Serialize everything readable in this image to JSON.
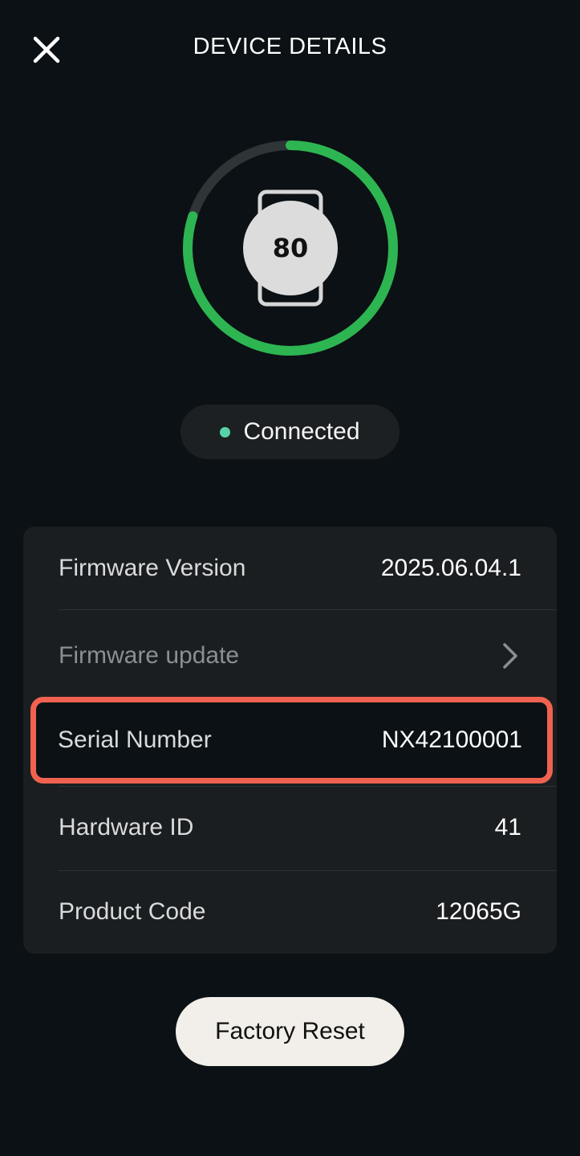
{
  "header": {
    "title": "DEVICE DETAILS",
    "close_icon": "close-icon"
  },
  "device": {
    "battery_level": "80",
    "battery_fraction": 0.8,
    "icon": "watch-icon",
    "ring_color": "#2db552",
    "ring_track_color": "#2f3436"
  },
  "status": {
    "label": "Connected",
    "dot_color": "#58d3a8"
  },
  "details": {
    "firmware_version_label": "Firmware Version",
    "firmware_version_value": "2025.06.04.1",
    "firmware_update_label": "Firmware update",
    "firmware_update_icon": "chevron-right-icon",
    "serial_number_label": "Serial Number",
    "serial_number_value": "NX42100001",
    "hardware_id_label": "Hardware ID",
    "hardware_id_value": "41",
    "product_code_label": "Product Code",
    "product_code_value": "12065G"
  },
  "highlight_color": "#f0624f",
  "actions": {
    "factory_reset_label": "Factory Reset"
  }
}
